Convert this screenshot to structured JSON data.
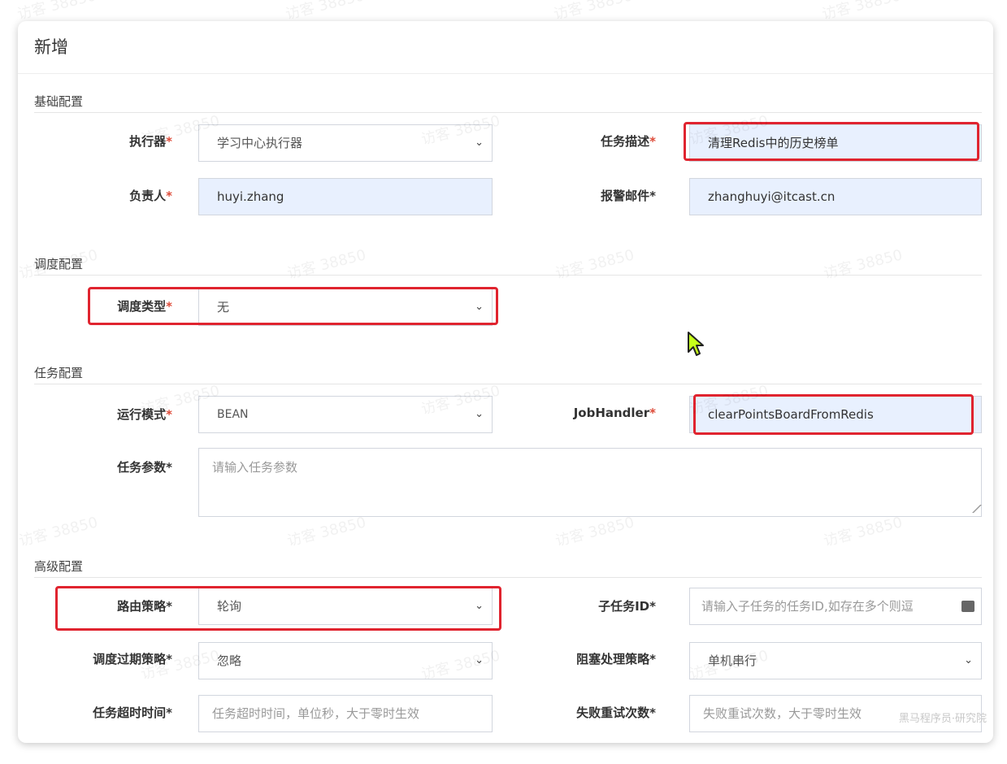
{
  "dialog": {
    "title": "新增"
  },
  "sections": {
    "basic": "基础配置",
    "schedule": "调度配置",
    "task": "任务配置",
    "advanced": "高级配置"
  },
  "fields": {
    "executor": {
      "label": "执行器",
      "value": "学习中心执行器"
    },
    "job_desc": {
      "label": "任务描述",
      "value": "清理Redis中的历史榜单"
    },
    "author": {
      "label": "负责人",
      "value": "huyi.zhang"
    },
    "alarm_email": {
      "label": "报警邮件",
      "value": "zhanghuyi@itcast.cn"
    },
    "schedule_type": {
      "label": "调度类型",
      "value": "无"
    },
    "run_mode": {
      "label": "运行模式",
      "value": "BEAN"
    },
    "job_handler": {
      "label": "JobHandler",
      "value": "clearPointsBoardFromRedis"
    },
    "job_param": {
      "label": "任务参数",
      "placeholder": "请输入任务参数"
    },
    "route_strategy": {
      "label": "路由策略",
      "value": "轮询"
    },
    "child_job_id": {
      "label": "子任务ID",
      "placeholder": "请输入子任务的任务ID,如存在多个则逗"
    },
    "misfire_strategy": {
      "label": "调度过期策略",
      "value": "忽略"
    },
    "block_strategy": {
      "label": "阻塞处理策略",
      "value": "单机串行"
    },
    "timeout": {
      "label": "任务超时时间",
      "placeholder": "任务超时时间，单位秒，大于零时生效"
    },
    "fail_retry": {
      "label": "失败重试次数",
      "placeholder": "失败重试次数，大于零时生效"
    }
  },
  "watermark": "访客 38850",
  "corner_mark": "黑马程序员·研究院",
  "colors": {
    "highlight": "#e0242f",
    "required_star": "#dd4b39",
    "autofill_bg": "#e8f0fe"
  }
}
